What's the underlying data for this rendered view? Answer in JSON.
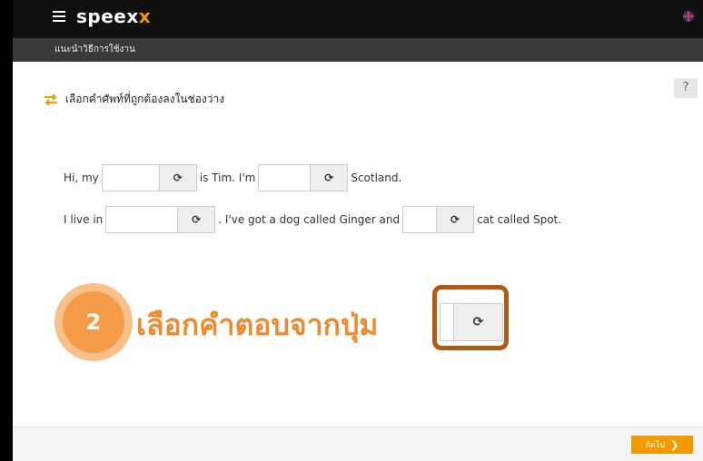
{
  "header": {
    "logo_main": "speex",
    "logo_accent": "x",
    "menu_icon": "hamburger-menu-icon",
    "language_flag_icon": "uk-flag-icon"
  },
  "subheader": {
    "title": "แนะนำวิธีการใช้งาน"
  },
  "help_button": {
    "label": "?"
  },
  "exercise": {
    "instruction_icon": "swap-arrows-icon",
    "instruction": "เลือกคำศัพท์ที่ถูกต้องลงในช่องว่าง",
    "refresh_glyph": "⟳",
    "line1": {
      "part1": "Hi, my",
      "part2": "is Tim. I'm",
      "part3": "Scotland."
    },
    "line2": {
      "part1": "I live in",
      "part2": ". I've got a dog called Ginger and",
      "part3": "cat called Spot."
    }
  },
  "callout": {
    "step_number": "2",
    "text": "เลือกคำตอบจากปุ่ม"
  },
  "footer": {
    "next_label": "ถัดไป",
    "next_chevron": "❯"
  },
  "colors": {
    "accent": "#f29a00",
    "callout_text": "#f18a2e",
    "badge_outer": "#fbbf8a",
    "badge_inner": "#f59a47",
    "highlight_border": "#b35a12",
    "topbar": "#101010",
    "subbar": "#3a3a3a"
  }
}
